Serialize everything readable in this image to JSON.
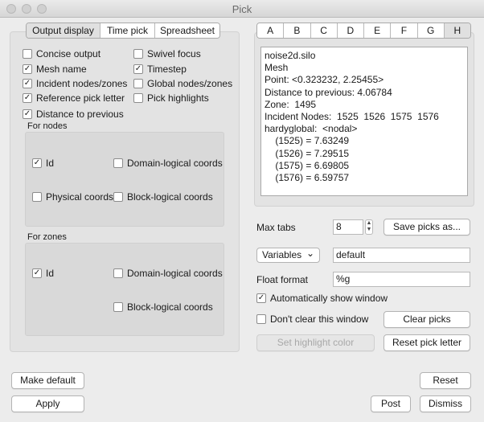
{
  "window": {
    "title": "Pick"
  },
  "left_tabs": [
    {
      "label": "Output display",
      "active": true
    },
    {
      "label": "Time pick",
      "active": false
    },
    {
      "label": "Spreadsheet",
      "active": false
    }
  ],
  "options": {
    "concise_output": {
      "label": "Concise output",
      "checked": false
    },
    "swivel_focus": {
      "label": "Swivel focus",
      "checked": false
    },
    "mesh_name": {
      "label": "Mesh name",
      "checked": true
    },
    "timestep": {
      "label": "Timestep",
      "checked": true
    },
    "incident_nodes": {
      "label": "Incident nodes/zones",
      "checked": true
    },
    "global_nodes": {
      "label": "Global nodes/zones",
      "checked": false
    },
    "reference_pick_letter": {
      "label": "Reference pick letter",
      "checked": true
    },
    "pick_highlights": {
      "label": "Pick highlights",
      "checked": false
    },
    "distance_to_previous": {
      "label": "Distance to previous",
      "checked": true
    }
  },
  "for_nodes": {
    "label": "For nodes",
    "id": {
      "label": "Id",
      "checked": true
    },
    "domain_logical": {
      "label": "Domain-logical coords",
      "checked": false
    },
    "physical": {
      "label": "Physical coords",
      "checked": false
    },
    "block_logical": {
      "label": "Block-logical coords",
      "checked": false
    }
  },
  "for_zones": {
    "label": "For zones",
    "id": {
      "label": "Id",
      "checked": true
    },
    "domain_logical": {
      "label": "Domain-logical coords",
      "checked": false
    },
    "block_logical": {
      "label": "Block-logical coords",
      "checked": false
    }
  },
  "pick_tabs": [
    "A",
    "B",
    "C",
    "D",
    "E",
    "F",
    "G",
    "H"
  ],
  "active_pick_tab": "H",
  "pick_output": [
    "noise2d.silo",
    "Mesh",
    "Point: <0.323232, 2.25455>",
    "Distance to previous: 4.06784",
    "Zone:  1495",
    "Incident Nodes:  1525  1526  1575  1576",
    "hardyglobal:  <nodal>",
    "    (1525) = 7.63249",
    "    (1526) = 7.29515",
    "    (1575) = 6.69805",
    "    (1576) = 6.59757"
  ],
  "max_tabs": {
    "label": "Max tabs",
    "value": "8",
    "up_arrow": "▲",
    "down_arrow": "▼"
  },
  "save_picks_label": "Save picks as...",
  "variables": {
    "selected": "Variables",
    "value": "default",
    "caret": "⌄"
  },
  "float_format": {
    "label": "Float format",
    "value": "%g"
  },
  "auto_show": {
    "label": "Automatically show window",
    "checked": true
  },
  "dont_clear": {
    "label": "Don't clear this window",
    "checked": false
  },
  "buttons": {
    "clear_picks": "Clear picks",
    "set_highlight_color": "Set highlight color",
    "reset_pick_letter": "Reset pick letter",
    "make_default": "Make default",
    "reset": "Reset",
    "apply": "Apply",
    "post": "Post",
    "dismiss": "Dismiss"
  },
  "check_glyph": "✓",
  "colors": {
    "background": "#ececec",
    "panel": "#e3e3e3",
    "subpanel": "#d9d9d9",
    "disabled_text": "#a8a8a8"
  }
}
